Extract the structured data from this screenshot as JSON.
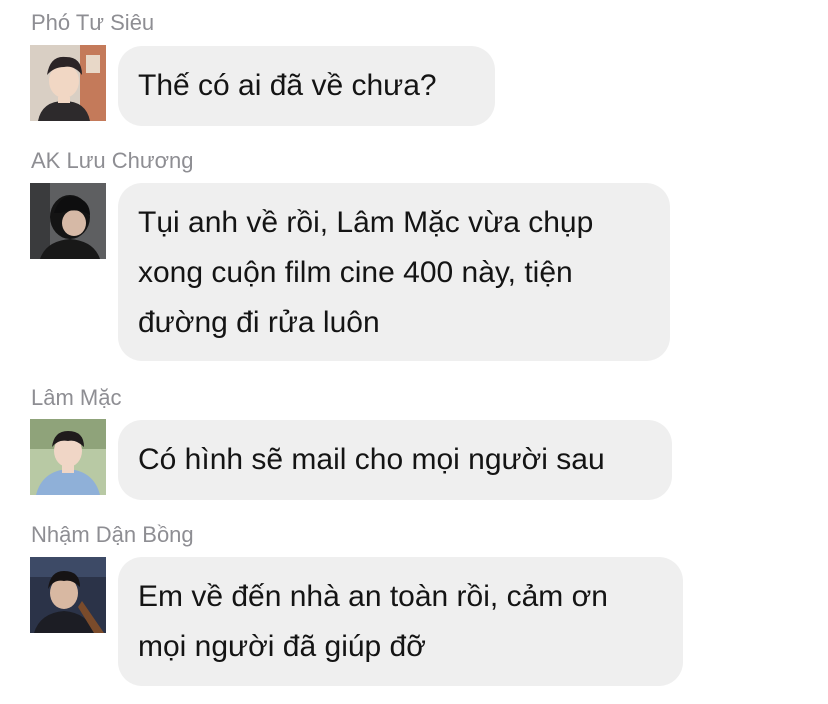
{
  "messages": [
    {
      "sender": "Phó Tư Siêu",
      "avatar_icon": "user-avatar-photo",
      "text": "Thế có ai đã về chưa?"
    },
    {
      "sender": "AK Lưu Chương",
      "avatar_icon": "user-avatar-photo",
      "text": "Tụi anh về rồi, Lâm Mặc vừa chụp\nxong cuộn film cine 400 này, tiện\nđường đi rửa luôn"
    },
    {
      "sender": "Lâm Mặc",
      "avatar_icon": "user-avatar-photo",
      "text": "Có hình sẽ mail cho mọi người sau"
    },
    {
      "sender": "Nhậm Dận Bồng",
      "avatar_icon": "user-avatar-photo",
      "text": "Em về đến nhà an toàn rồi, cảm ơn\nmọi người đã giúp đỡ"
    }
  ],
  "colors": {
    "bubble_background": "#efefef",
    "sender_name": "#8e8e93",
    "message_text": "#141414"
  }
}
